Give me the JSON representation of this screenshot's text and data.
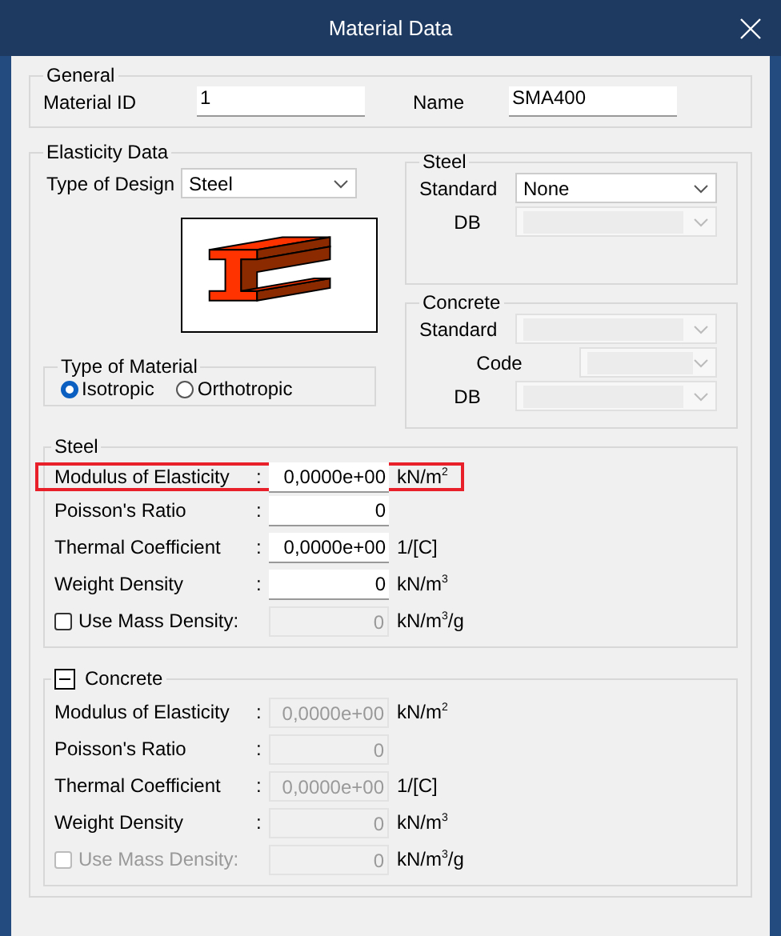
{
  "window": {
    "title": "Material Data"
  },
  "general": {
    "label": "General",
    "fields": [
      {
        "label": "Material ID",
        "value": "1"
      },
      {
        "label": "Name",
        "value": "SMA400"
      }
    ]
  },
  "elasticity": {
    "label": "Elasticity Data",
    "type_of_design": {
      "label": "Type of Design",
      "value": "Steel"
    },
    "type_of_material": {
      "label": "Type of Material",
      "options": [
        {
          "label": "Isotropic",
          "selected": true
        },
        {
          "label": "Orthotropic",
          "selected": false
        }
      ]
    },
    "steel_standard": {
      "label": "Steel",
      "rows": [
        {
          "label": "Standard",
          "value": "None",
          "disabled": false
        },
        {
          "label": "DB",
          "disabled": true
        }
      ]
    },
    "concrete_standard": {
      "label": "Concrete",
      "rows": [
        {
          "label": "Standard",
          "disabled": true
        },
        {
          "label": "Code",
          "disabled": true
        },
        {
          "label": "DB",
          "disabled": true
        }
      ]
    },
    "steel_properties": {
      "label": "Steel",
      "rows": [
        {
          "kind": "field",
          "label": "Modulus of Elasticity",
          "separator": ":",
          "value": "0,0000e+00",
          "unit": "kN/m$^{2}$",
          "disabled": false,
          "highlighted": true
        },
        {
          "kind": "field",
          "label": "Poisson's Ratio",
          "separator": ":",
          "value": "0",
          "disabled": false,
          "highlighted": false
        },
        {
          "kind": "field",
          "label": "Thermal Coefficient",
          "separator": ":",
          "value": "0,0000e+00",
          "unit": "1/[C]",
          "disabled": false,
          "highlighted": false
        },
        {
          "kind": "field",
          "label": "Weight Density",
          "separator": ":",
          "value": "0",
          "unit": "kN/m$^{3}$",
          "disabled": false,
          "highlighted": false
        },
        {
          "kind": "checkbox",
          "label": "Use Mass Density:",
          "value": "0",
          "unit": "kN/m$^{3}$/g",
          "checked": false,
          "disabled": false,
          "field_disabled": true,
          "highlighted": false
        }
      ]
    },
    "concrete_properties": {
      "label": "Concrete",
      "expanded": true,
      "rows": [
        {
          "kind": "field",
          "label": "Modulus of Elasticity",
          "separator": ":",
          "value": "0,0000e+00",
          "unit": "kN/m$^{2}$",
          "disabled": true,
          "highlighted": false
        },
        {
          "kind": "field",
          "label": "Poisson's Ratio",
          "separator": ":",
          "value": "0",
          "disabled": true,
          "highlighted": false
        },
        {
          "kind": "field",
          "label": "Thermal Coefficient",
          "separator": ":",
          "value": "0,0000e+00",
          "unit": "1/[C]",
          "disabled": true,
          "highlighted": false
        },
        {
          "kind": "field",
          "label": "Weight Density",
          "separator": ":",
          "value": "0",
          "unit": "kN/m$^{3}$",
          "disabled": true,
          "highlighted": false
        },
        {
          "kind": "checkbox",
          "label": "Use Mass Density:",
          "value": "0",
          "unit": "kN/m$^{3}$/g",
          "checked": false,
          "disabled": true,
          "field_disabled": true,
          "highlighted": false
        }
      ]
    }
  }
}
